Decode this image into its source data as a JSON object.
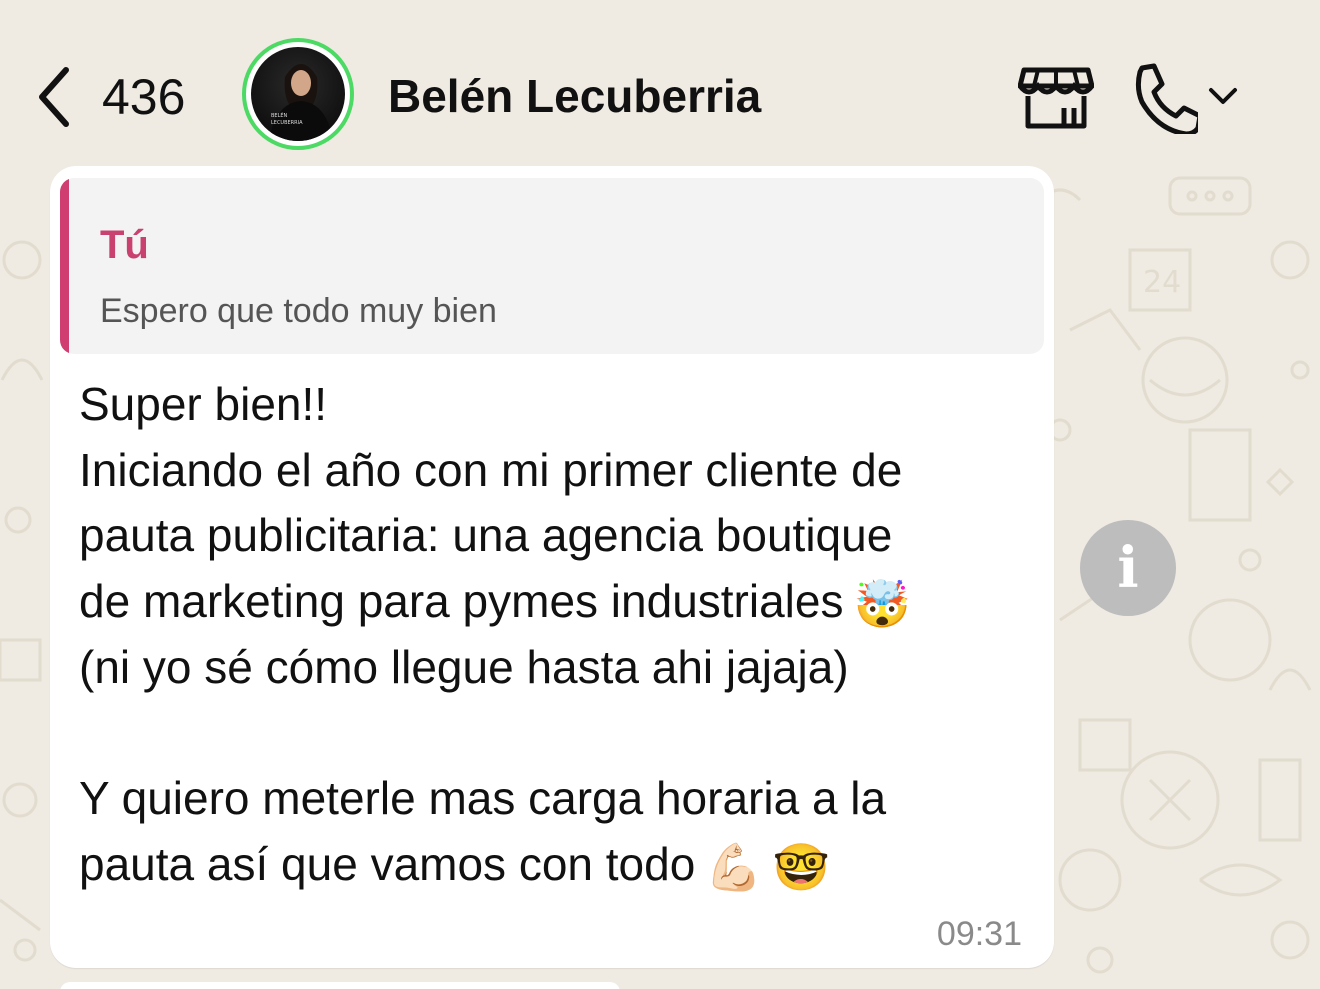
{
  "header": {
    "back_count": "436",
    "contact_name": "Belén Lecuberria",
    "avatar_text": "BELÉN LECUBERRIA",
    "online_ring_color": "#4cd964",
    "icons": {
      "back": "chevron-left-icon",
      "store": "store-icon",
      "call": "phone-icon",
      "call_menu": "chevron-down-icon"
    }
  },
  "message": {
    "quote": {
      "author": "Tú",
      "text": "Espero que todo muy bien",
      "accent_color": "#cf3d71"
    },
    "lines": [
      "Super bien!!",
      "Iniciando el año con mi primer cliente de",
      "pauta publicitaria: una agencia boutique",
      "de marketing para pymes industriales",
      "(ni yo sé cómo llegue hasta ahi jajaja)",
      "",
      "Y quiero meterle mas carga horaria a la",
      "pauta así que vamos con todo"
    ],
    "emojis": {
      "line4": "🤯",
      "line8_a": "💪🏻",
      "line8_b": "🤓"
    },
    "time": "09:31"
  },
  "info_button": {
    "icon": "info-icon",
    "label": "i"
  }
}
